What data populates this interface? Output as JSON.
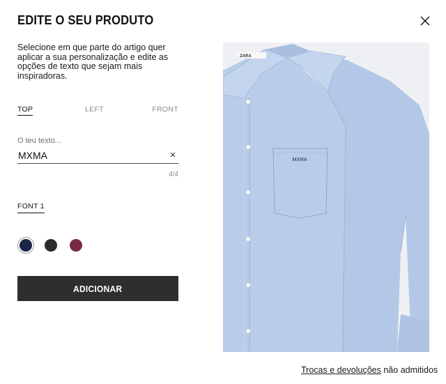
{
  "modal": {
    "title": "EDITE O SEU PRODUTO",
    "description": "Selecione em que parte do artigo quer aplicar a sua personalização e edite as opções de texto que sejam mais inspiradoras."
  },
  "placement_tabs": [
    {
      "label": "TOP",
      "active": true
    },
    {
      "label": "LEFT",
      "active": false
    },
    {
      "label": "FRONT",
      "active": false
    }
  ],
  "text_field": {
    "label": "O teu texto...",
    "value": "MXMA",
    "counter": "4/4"
  },
  "font": {
    "label": "FONT 1"
  },
  "colors": [
    {
      "name": "navy",
      "hex": "#1c2447",
      "selected": true
    },
    {
      "name": "black",
      "hex": "#2b2b2b",
      "selected": false
    },
    {
      "name": "burgundy",
      "hex": "#7a2a42",
      "selected": false
    }
  ],
  "add_button": {
    "label": "ADICIONAR"
  },
  "preview": {
    "shirt_color": "#b9cde9",
    "embroidery_text": "MXMA",
    "brand": "ZARA"
  },
  "footer": {
    "link_text": "Trocas e devoluções",
    "suffix_text": "não admitidos"
  }
}
